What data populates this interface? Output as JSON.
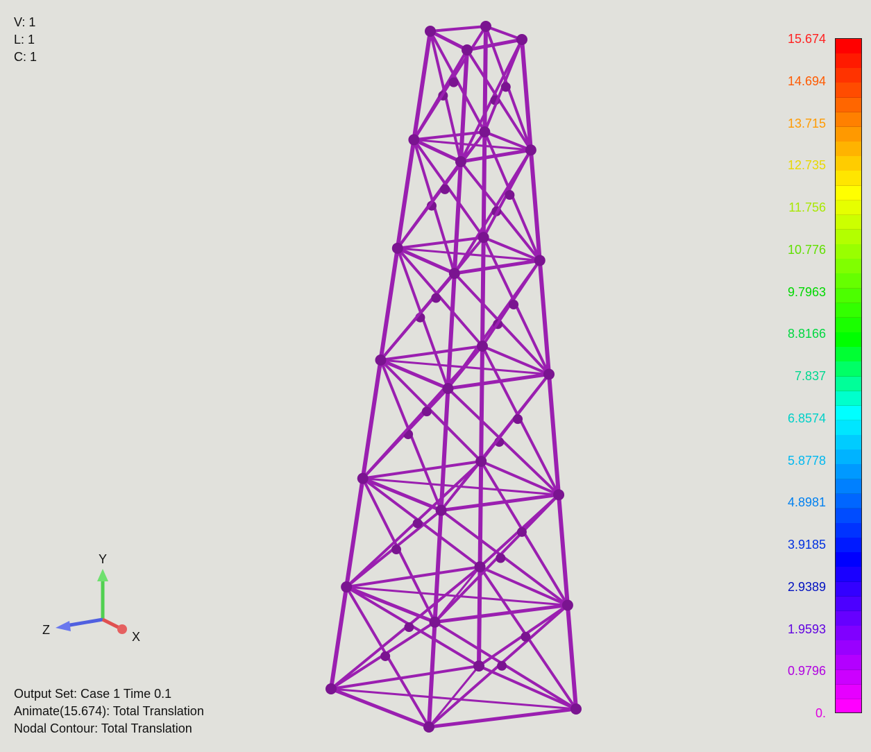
{
  "view_info": {
    "view": "V: 1",
    "layer": "L: 1",
    "color": "C: 1"
  },
  "output_info": {
    "output_set": "Output Set: Case 1 Time 0.1",
    "animate": "Animate(15.674): Total Translation",
    "contour": "Nodal Contour: Total Translation"
  },
  "axes_triad": {
    "x_label": "X",
    "y_label": "Y",
    "z_label": "Z",
    "x_color": "#e05050",
    "y_color": "#50d050",
    "z_color": "#5060e0"
  },
  "model": {
    "description_color": "#9a1fb0",
    "node_color": "#7a1490"
  },
  "legend": {
    "labels": [
      {
        "text": "15.674",
        "color": "#ff2020"
      },
      {
        "text": "14.694",
        "color": "#ff5a00"
      },
      {
        "text": "13.715",
        "color": "#ff9a00"
      },
      {
        "text": "12.735",
        "color": "#e8d800"
      },
      {
        "text": "11.756",
        "color": "#a8e800"
      },
      {
        "text": "10.776",
        "color": "#60e000"
      },
      {
        "text": "9.7963",
        "color": "#00d800"
      },
      {
        "text": "8.8166",
        "color": "#00d840"
      },
      {
        "text": "7.837",
        "color": "#00d890"
      },
      {
        "text": "6.8574",
        "color": "#00d0c8"
      },
      {
        "text": "5.8778",
        "color": "#00b8f0"
      },
      {
        "text": "4.8981",
        "color": "#0080f0"
      },
      {
        "text": "3.9185",
        "color": "#0030e0"
      },
      {
        "text": "2.9389",
        "color": "#0010c0"
      },
      {
        "text": "1.9593",
        "color": "#6000e0"
      },
      {
        "text": "0.9796",
        "color": "#b000e0"
      },
      {
        "text": "0.",
        "color": "#e000e0"
      }
    ],
    "bands": [
      "#ff0000",
      "#ff1a00",
      "#ff3300",
      "#ff4c00",
      "#ff6600",
      "#ff8000",
      "#ff9900",
      "#ffb300",
      "#ffcc00",
      "#ffe600",
      "#ffff00",
      "#e6ff00",
      "#ccff00",
      "#b3ff00",
      "#99ff00",
      "#80ff00",
      "#66ff00",
      "#4cff00",
      "#33ff00",
      "#1aff00",
      "#00ff00",
      "#00ff33",
      "#00ff66",
      "#00ff99",
      "#00ffcc",
      "#00ffff",
      "#00e6ff",
      "#00ccff",
      "#00b3ff",
      "#0099ff",
      "#0080ff",
      "#0066ff",
      "#004cff",
      "#0033ff",
      "#001aff",
      "#0000ff",
      "#1a00ff",
      "#3300ff",
      "#4c00ff",
      "#6600ff",
      "#8000ff",
      "#9900ff",
      "#b300ff",
      "#cc00ff",
      "#e600ff",
      "#ff00ff"
    ]
  }
}
